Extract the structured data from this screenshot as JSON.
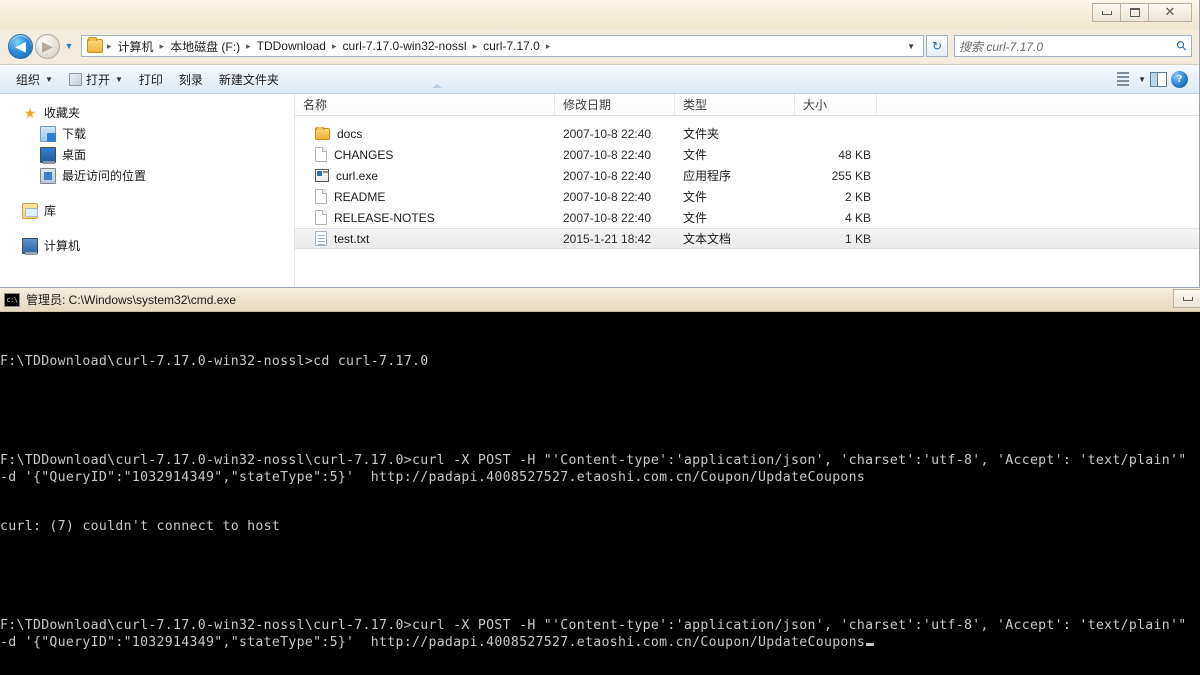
{
  "explorer": {
    "window_controls": {
      "minimize": "—",
      "maximize": "□",
      "close": "✕"
    },
    "nav": {
      "back": "◀",
      "forward": "▶",
      "history_caret": "▼"
    },
    "address": {
      "folder_icon": "folder-icon",
      "crumbs": [
        "计算机",
        "本地磁盘 (F:)",
        "TDDownload",
        "curl-7.17.0-win32-nossl",
        "curl-7.17.0"
      ],
      "separator": "▸",
      "trailing_separator": "▸",
      "dropdown_caret": "▼",
      "refresh_icon": "↻"
    },
    "search": {
      "placeholder": "搜索 curl-7.17.0",
      "icon": "search-icon"
    },
    "toolbar": {
      "organize": "组织",
      "open": "打开",
      "print": "打印",
      "burn": "刻录",
      "new_folder": "新建文件夹",
      "caret": "▼",
      "views_icon": "views-icon",
      "preview_pane_icon": "preview-pane-icon",
      "help_icon": "help-icon",
      "help_glyph": "?"
    },
    "navpane": {
      "groups": [
        {
          "label": "收藏夹",
          "icon": "favorites-star-icon",
          "children": [
            {
              "label": "下载",
              "icon": "downloads-icon"
            },
            {
              "label": "桌面",
              "icon": "desktop-icon"
            },
            {
              "label": "最近访问的位置",
              "icon": "recent-places-icon"
            }
          ]
        },
        {
          "label": "库",
          "icon": "libraries-icon",
          "children": []
        },
        {
          "label": "计算机",
          "icon": "computer-icon",
          "children": []
        }
      ]
    },
    "file_list": {
      "columns": [
        "名称",
        "修改日期",
        "类型",
        "大小"
      ],
      "rows": [
        {
          "name": "docs",
          "date": "2007-10-8 22:40",
          "type": "文件夹",
          "size": "",
          "icon": "folder-icon",
          "selected": false
        },
        {
          "name": "CHANGES",
          "date": "2007-10-8 22:40",
          "type": "文件",
          "size": "48 KB",
          "icon": "file-icon",
          "selected": false
        },
        {
          "name": "curl.exe",
          "date": "2007-10-8 22:40",
          "type": "应用程序",
          "size": "255 KB",
          "icon": "application-icon",
          "selected": false
        },
        {
          "name": "README",
          "date": "2007-10-8 22:40",
          "type": "文件",
          "size": "2 KB",
          "icon": "file-icon",
          "selected": false
        },
        {
          "name": "RELEASE-NOTES",
          "date": "2007-10-8 22:40",
          "type": "文件",
          "size": "4 KB",
          "icon": "file-icon",
          "selected": false
        },
        {
          "name": "test.txt",
          "date": "2015-1-21 18:42",
          "type": "文本文档",
          "size": "1 KB",
          "icon": "text-file-icon",
          "selected": true
        }
      ]
    }
  },
  "cmd": {
    "title": "管理员: C:\\Windows\\system32\\cmd.exe",
    "icon": "cmd-icon",
    "window_controls": {
      "minimize": "—",
      "maximize": "□"
    },
    "lines": [
      "F:\\TDDownload\\curl-7.17.0-win32-nossl>cd curl-7.17.0",
      "",
      "F:\\TDDownload\\curl-7.17.0-win32-nossl\\curl-7.17.0>curl -X POST -H \"'Content-type':'application/json', 'charset':'utf-8', 'Accept': 'text/plain'\" -d '{\"QueryID\":\"1032914349\",\"stateType\":5}'  http://padapi.4008527527.etaoshi.com.cn/Coupon/UpdateCoupons",
      "curl: (7) couldn't connect to host",
      "",
      "F:\\TDDownload\\curl-7.17.0-win32-nossl\\curl-7.17.0>curl -X POST -H \"'Content-type':'application/json', 'charset':'utf-8', 'Accept': 'text/plain'\" -d '{\"QueryID\":\"1032914349\",\"stateType\":5}'  http://padapi.4008527527.etaoshi.com.cn/Coupon/UpdateCoupons"
    ],
    "cursor": "_"
  },
  "colors": {
    "desktop": "#000000",
    "glass": "#f3ecdf",
    "accent_blue": "#2f8fd8",
    "console_bg": "#000000",
    "console_fg": "#c8c8c8",
    "selected_row": "#ebebeb"
  }
}
